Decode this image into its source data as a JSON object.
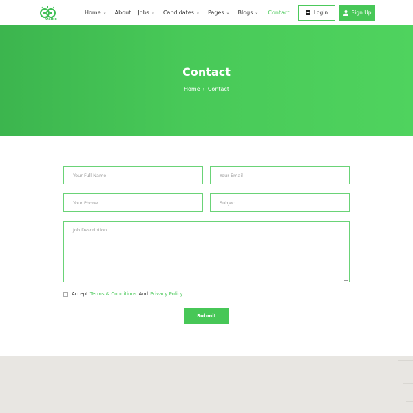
{
  "header": {
    "logo_text": "Oaltix",
    "nav": [
      {
        "label": "Home",
        "has_dropdown": true,
        "active": false
      },
      {
        "label": "About",
        "has_dropdown": false,
        "active": false
      },
      {
        "label": "Jobs",
        "has_dropdown": true,
        "active": false
      },
      {
        "label": "Candidates",
        "has_dropdown": true,
        "active": false
      },
      {
        "label": "Pages",
        "has_dropdown": true,
        "active": false
      },
      {
        "label": "Blogs",
        "has_dropdown": true,
        "active": false
      },
      {
        "label": "Contact",
        "has_dropdown": false,
        "active": true
      }
    ],
    "login_label": "Login",
    "signup_label": "Sign Up"
  },
  "hero": {
    "title": "Contact",
    "breadcrumb": [
      "Home",
      "Contact"
    ]
  },
  "form": {
    "full_name_placeholder": "Your Full Name",
    "email_placeholder": "Your Email",
    "phone_placeholder": "Your Phone",
    "subject_placeholder": "Subject",
    "description_placeholder": "Job Description",
    "accept_prefix": "Accept",
    "terms_link": "Terms & Conditions",
    "and_text": "And",
    "privacy_link": "Privacy Policy",
    "submit_label": "Submit"
  },
  "colors": {
    "accent": "#4cc95b",
    "hero_start": "#3cb54e",
    "hero_end": "#4fd35e",
    "map_bg": "#e8e6e2"
  },
  "icons": {
    "login": "login-icon",
    "signup": "user-icon",
    "dropdown": "chevron-down-icon"
  }
}
